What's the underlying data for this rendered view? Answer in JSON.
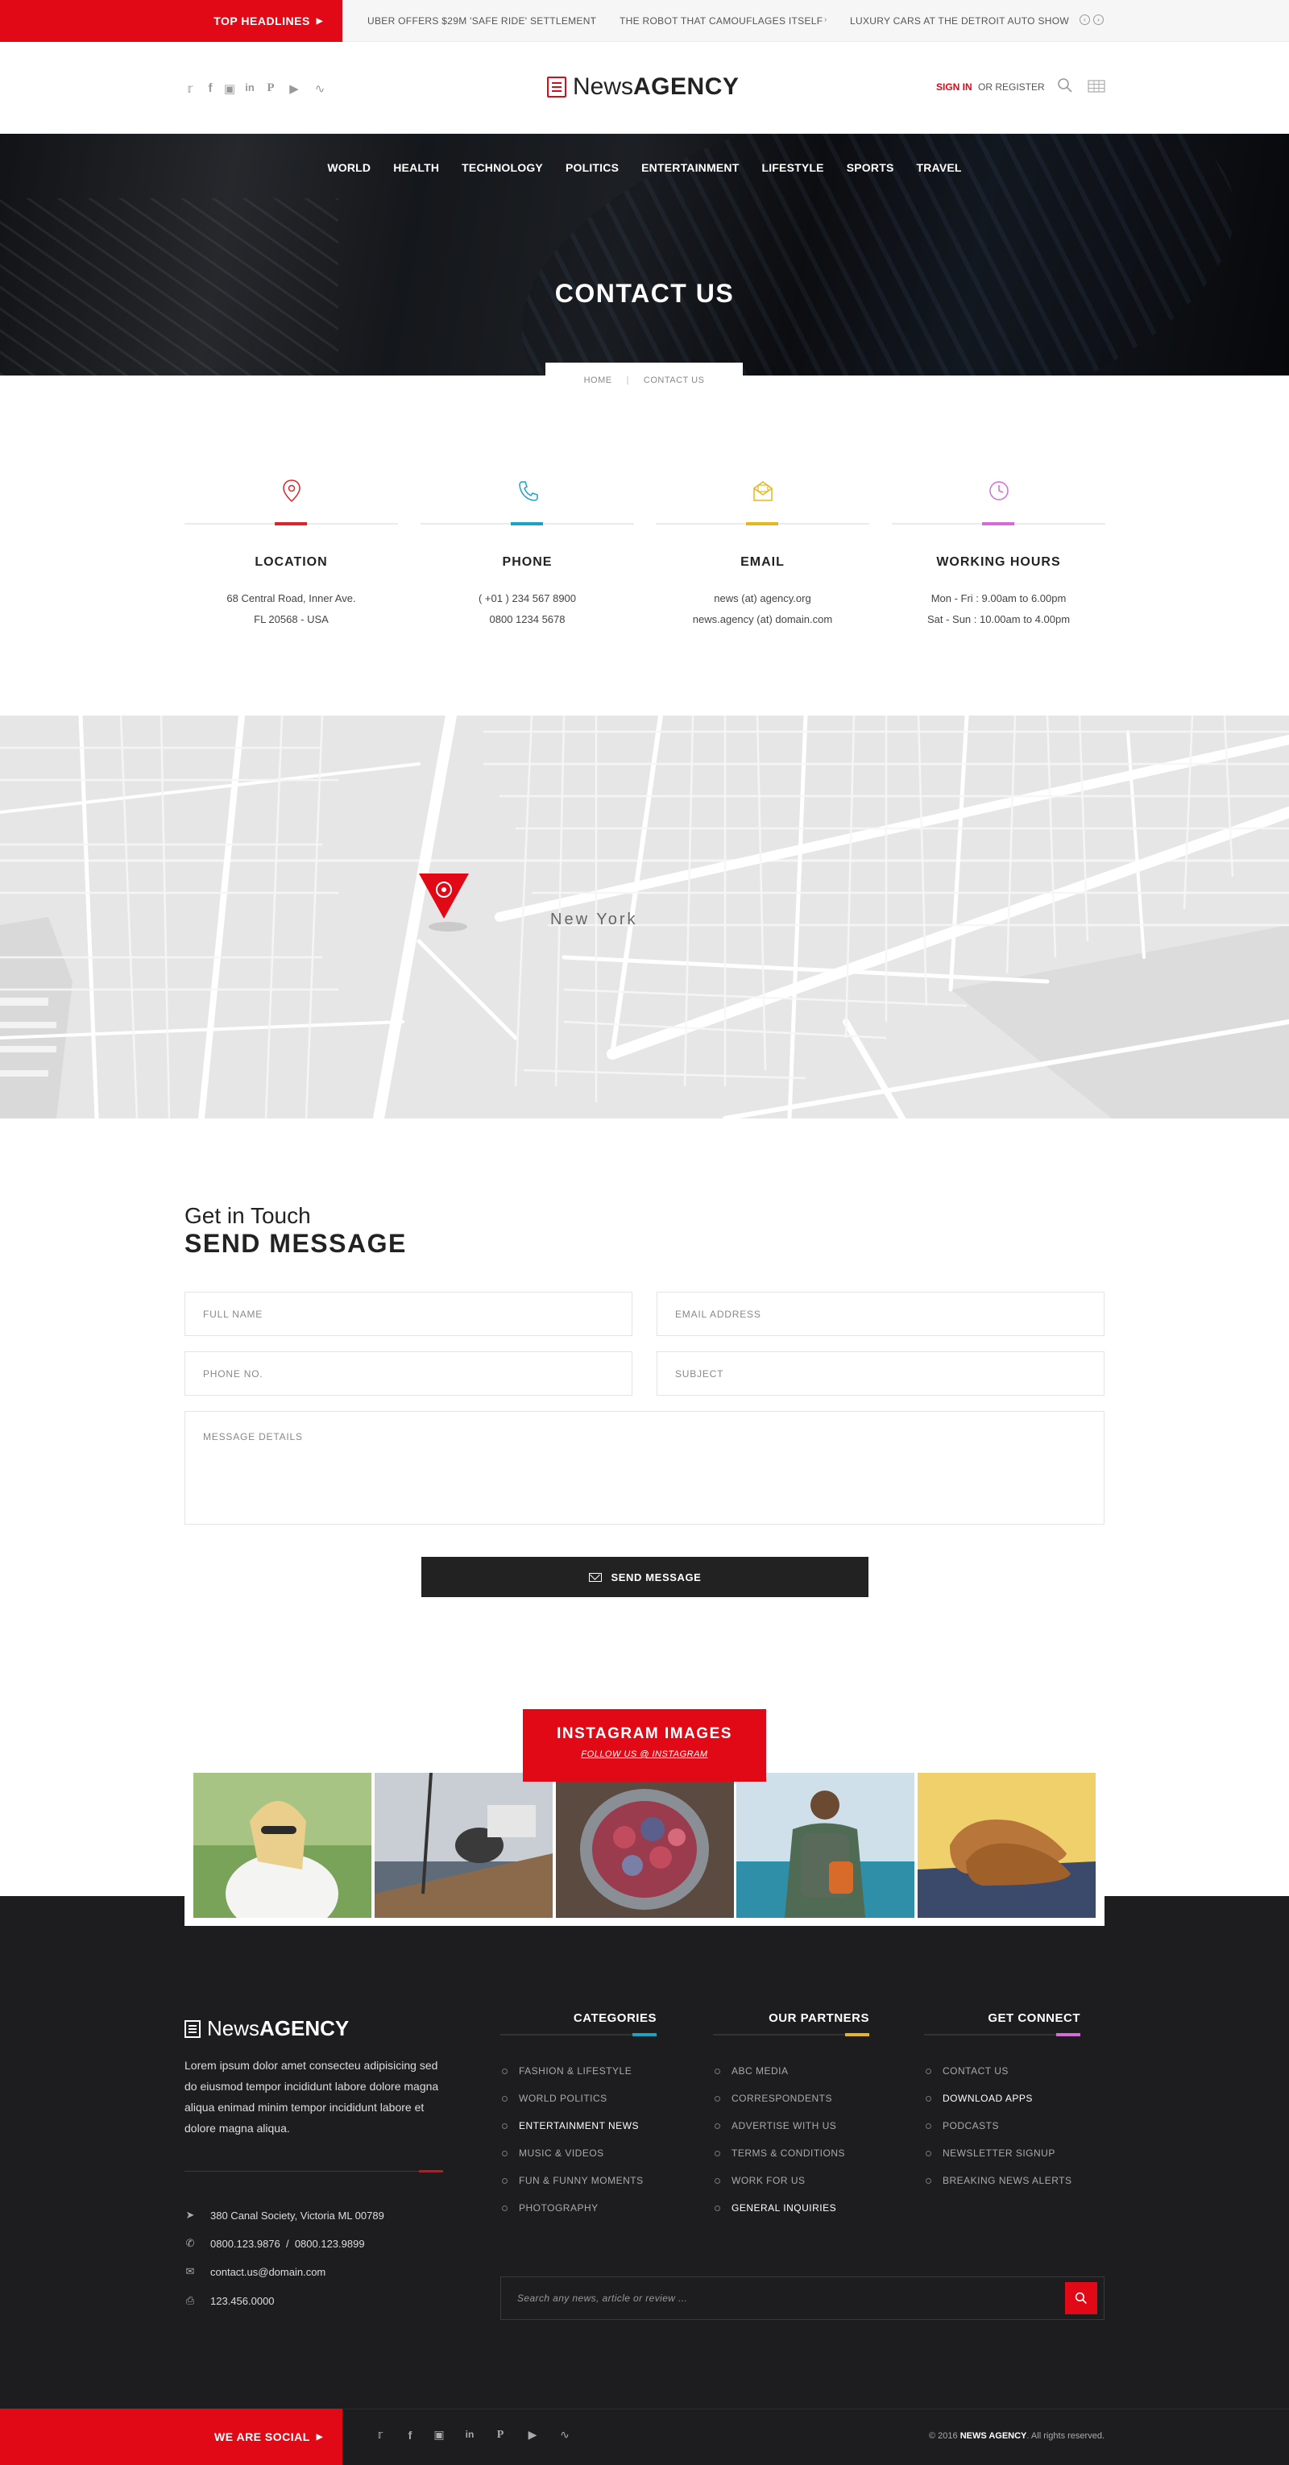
{
  "top_headlines": {
    "label": "TOP HEADLINES",
    "items": [
      "UBER OFFERS $29M 'SAFE RIDE' SETTLEMENT",
      "THE ROBOT THAT CAMOUFLAGES ITSELF",
      "LUXURY CARS AT THE DETROIT AUTO SHOW"
    ]
  },
  "header": {
    "logo_news": "News",
    "logo_agency": "AGENCY",
    "sign_in": "SIGN IN",
    "register": "OR REGISTER",
    "social_icons": [
      "twitter-icon",
      "facebook-icon",
      "instagram-icon",
      "linkedin-icon",
      "pinterest-icon",
      "youtube-icon",
      "rss-icon"
    ]
  },
  "nav": {
    "items": [
      "WORLD",
      "HEALTH",
      "TECHNOLOGY",
      "POLITICS",
      "ENTERTAINMENT",
      "LIFESTYLE",
      "SPORTS",
      "TRAVEL"
    ]
  },
  "hero": {
    "title": "CONTACT US",
    "breadcrumb": [
      "HOME",
      "CONTACT US"
    ]
  },
  "contact_info": [
    {
      "icon": "location-pin-icon",
      "accent": "#d9262c",
      "title": "LOCATION",
      "line1": "68 Central Road, Inner Ave.",
      "line2": "FL 20568 - USA"
    },
    {
      "icon": "phone-icon",
      "accent": "#1ba3c6",
      "title": "PHONE",
      "line1": "( +01 ) 234 567 8900",
      "line2": "0800 1234 5678"
    },
    {
      "icon": "email-icon",
      "accent": "#e3b81e",
      "title": "EMAIL",
      "line1": "news (at) agency.org",
      "line2": "news.agency (at) domain.com"
    },
    {
      "icon": "clock-icon",
      "accent": "#d46cd8",
      "title": "WORKING HOURS",
      "line1": "Mon - Fri : 9.00am to 6.00pm",
      "line2": "Sat - Sun : 10.00am to 4.00pm"
    }
  ],
  "map": {
    "city_label": "New York"
  },
  "form": {
    "kicker": "Get in Touch",
    "title": "SEND MESSAGE",
    "full_name_placeholder": "FULL NAME",
    "email_placeholder": "EMAIL ADDRESS",
    "phone_placeholder": "PHONE NO.",
    "subject_placeholder": "SUBJECT",
    "message_placeholder": "MESSAGE DETAILS",
    "send_label": "SEND MESSAGE"
  },
  "instagram": {
    "title": "INSTAGRAM IMAGES",
    "follow": "FOLLOW US @ INSTAGRAM"
  },
  "footer": {
    "logo_news": "News",
    "logo_agency": "AGENCY",
    "about": "Lorem ipsum dolor amet consecteu adipisicing sed do eiusmod tempor incididunt labore dolore magna aliqua enimad minim tempor incididunt labore et dolore magna aliqua.",
    "address": "380 Canal Society, Victoria ML 00789",
    "phone": "0800.123.9876  /  0800.123.9899",
    "email": "contact.us@domain.com",
    "fax": "123.456.0000",
    "categories_title": "CATEGORIES",
    "categories": [
      {
        "label": "FASHION & LIFESTYLE",
        "hl": false
      },
      {
        "label": "WORLD POLITICS",
        "hl": false
      },
      {
        "label": "ENTERTAINMENT NEWS",
        "hl": true
      },
      {
        "label": "MUSIC & VIDEOS",
        "hl": false
      },
      {
        "label": "FUN & FUNNY MOMENTS",
        "hl": false
      },
      {
        "label": "PHOTOGRAPHY",
        "hl": false
      }
    ],
    "partners_title": "OUR PARTNERS",
    "partners": [
      {
        "label": "ABC MEDIA",
        "hl": false
      },
      {
        "label": "CORRESPONDENTS",
        "hl": false
      },
      {
        "label": "ADVERTISE WITH US",
        "hl": false
      },
      {
        "label": "TERMS & CONDITIONS",
        "hl": false
      },
      {
        "label": "WORK FOR US",
        "hl": false
      },
      {
        "label": "GENERAL INQUIRIES",
        "hl": true
      }
    ],
    "connect_title": "GET CONNECT",
    "connect": [
      {
        "label": "CONTACT US",
        "hl": false
      },
      {
        "label": "DOWNLOAD APPS",
        "hl": true
      },
      {
        "label": "PODCASTS",
        "hl": false
      },
      {
        "label": "NEWSLETTER SIGNUP",
        "hl": false
      },
      {
        "label": "BREAKING NEWS ALERTS",
        "hl": false
      }
    ],
    "search_placeholder": "Search any news, article or review ...",
    "accent_colors": {
      "categories": "#1ba3c6",
      "partners": "#e3b81e",
      "connect": "#d46cd8"
    }
  },
  "bottom": {
    "social_label": "WE ARE SOCIAL",
    "copyright_prefix": "© 2016",
    "copyright_brand": "NEWS AGENCY",
    "copyright_suffix": ". All rights reserved."
  },
  "colors": {
    "brand_red": "#e10916",
    "dark": "#1d1d1f"
  }
}
